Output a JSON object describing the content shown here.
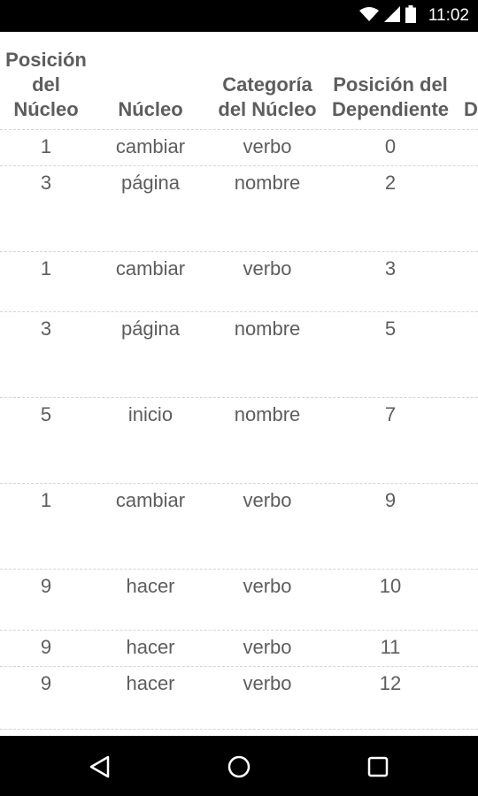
{
  "status_bar": {
    "time": "11:02",
    "icons": [
      "wifi-icon",
      "signal-icon",
      "battery-icon"
    ]
  },
  "table": {
    "columns": [
      "Posición\ndel\nNúcleo",
      "Núcleo",
      "Categoría\ndel Núcleo",
      "Posición del\nDependiente",
      "D"
    ],
    "rows": [
      {
        "pos_nucleo": "1",
        "nucleo": "cambiar",
        "categoria": "verbo",
        "pos_dep": "0"
      },
      {
        "pos_nucleo": "3",
        "nucleo": "página",
        "categoria": "nombre",
        "pos_dep": "2"
      },
      {
        "pos_nucleo": "1",
        "nucleo": "cambiar",
        "categoria": "verbo",
        "pos_dep": "3"
      },
      {
        "pos_nucleo": "3",
        "nucleo": "página",
        "categoria": "nombre",
        "pos_dep": "5"
      },
      {
        "pos_nucleo": "5",
        "nucleo": "inicio",
        "categoria": "nombre",
        "pos_dep": "7"
      },
      {
        "pos_nucleo": "1",
        "nucleo": "cambiar",
        "categoria": "verbo",
        "pos_dep": "9"
      },
      {
        "pos_nucleo": "9",
        "nucleo": "hacer",
        "categoria": "verbo",
        "pos_dep": "10"
      },
      {
        "pos_nucleo": "9",
        "nucleo": "hacer",
        "categoria": "verbo",
        "pos_dep": "11"
      },
      {
        "pos_nucleo": "9",
        "nucleo": "hacer",
        "categoria": "verbo",
        "pos_dep": "12"
      }
    ]
  },
  "nav_bar": {
    "buttons": [
      "back",
      "home",
      "recents"
    ]
  }
}
